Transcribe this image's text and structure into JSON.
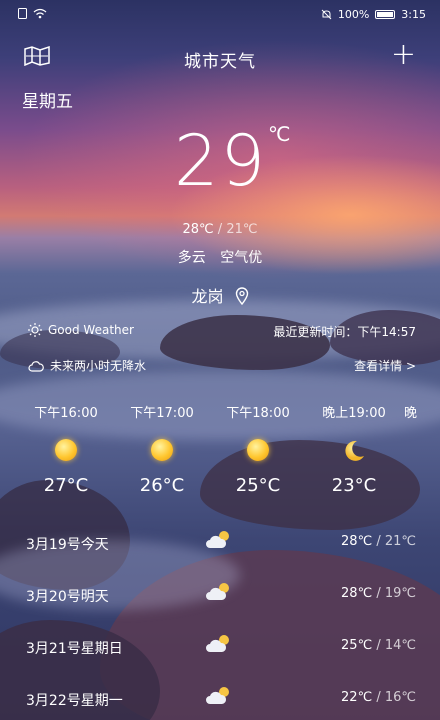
{
  "status": {
    "battery": "100%",
    "time": "3:15"
  },
  "header": {
    "title": "城市天气",
    "add": "+"
  },
  "weekday": "星期五",
  "current": {
    "temp": "29",
    "unit": "℃",
    "high": "28℃",
    "sep": " / ",
    "low": "21℃",
    "weather": "多云",
    "air": "空气优",
    "city": "龙岗"
  },
  "info": {
    "good_weather": "Good Weather",
    "updated": "最近更新时间：下午14:57",
    "rain": "未来两小时无降水",
    "detail": "查看详情 >"
  },
  "hourly": [
    {
      "time": "下午16:00",
      "icon": "sun-icon",
      "temp": "27°C"
    },
    {
      "time": "下午17:00",
      "icon": "sun-icon",
      "temp": "26°C"
    },
    {
      "time": "下午18:00",
      "icon": "sun-icon",
      "temp": "25°C"
    },
    {
      "time": "晚上19:00",
      "icon": "moon-icon",
      "temp": "23°C"
    },
    {
      "time": "晚",
      "icon": "",
      "temp": ""
    }
  ],
  "daily": [
    {
      "date": "3月19号今天",
      "icon": "cloud-sun-icon",
      "high": "28℃",
      "sep": " / ",
      "low": "21℃"
    },
    {
      "date": "3月20号明天",
      "icon": "cloud-sun-icon",
      "high": "28℃",
      "sep": " / ",
      "low": "19℃"
    },
    {
      "date": "3月21号星期日",
      "icon": "cloud-sun-icon",
      "high": "25℃",
      "sep": " / ",
      "low": "14℃"
    },
    {
      "date": "3月22号星期一",
      "icon": "cloud-sun-icon",
      "high": "22℃",
      "sep": " / ",
      "low": "16℃"
    }
  ]
}
